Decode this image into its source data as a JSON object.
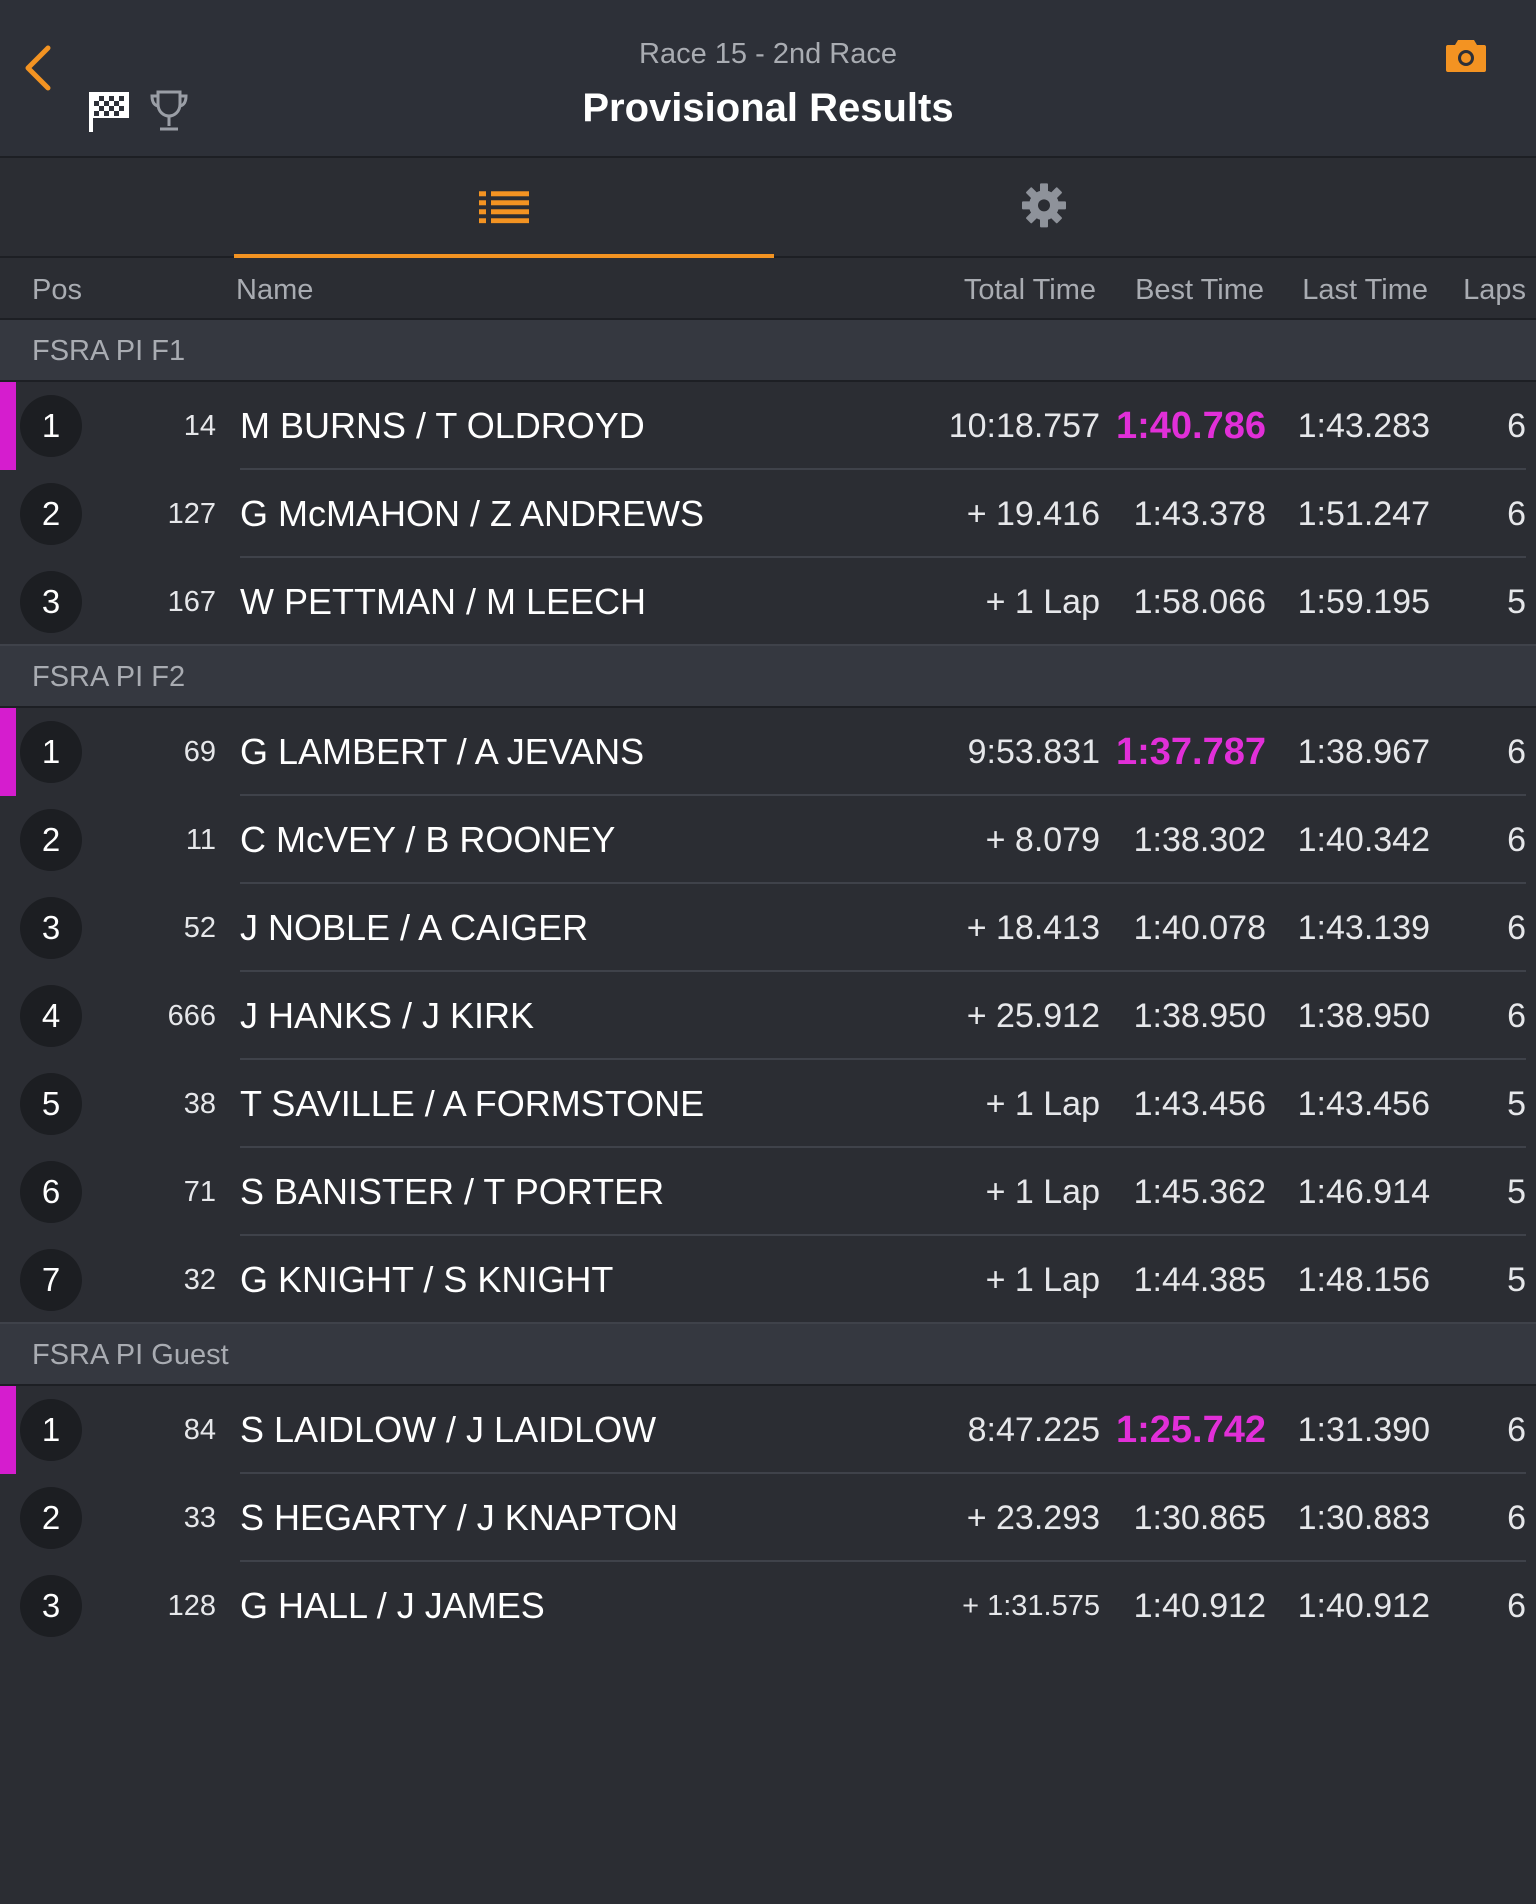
{
  "header": {
    "subtitle": "Race 15 - 2nd Race",
    "title": "Provisional Results",
    "accent_color": "#f39322",
    "icons": [
      "chevron-left-icon",
      "checkered-flag-icon",
      "trophy-icon",
      "camera-icon"
    ]
  },
  "tabs": [
    {
      "icon": "list-icon",
      "selected": true
    },
    {
      "icon": "gear-icon",
      "selected": false
    }
  ],
  "columns": {
    "pos": "Pos",
    "name": "Name",
    "total": "Total Time",
    "best": "Best Time",
    "last": "Last Time",
    "laps": "Laps"
  },
  "groups": [
    {
      "name": "FSRA PI F1",
      "rows": [
        {
          "pos": "1",
          "num": "14",
          "name": "M BURNS / T OLDROYD",
          "total": "10:18.757",
          "best": "1:40.786",
          "last": "1:43.283",
          "laps": "6",
          "fastest": true
        },
        {
          "pos": "2",
          "num": "127",
          "name": "G McMAHON / Z ANDREWS",
          "total": "+ 19.416",
          "best": "1:43.378",
          "last": "1:51.247",
          "laps": "6",
          "fastest": false
        },
        {
          "pos": "3",
          "num": "167",
          "name": "W PETTMAN / M LEECH",
          "total": "+ 1 Lap",
          "best": "1:58.066",
          "last": "1:59.195",
          "laps": "5",
          "fastest": false
        }
      ]
    },
    {
      "name": "FSRA PI F2",
      "rows": [
        {
          "pos": "1",
          "num": "69",
          "name": "G LAMBERT / A JEVANS",
          "total": "9:53.831",
          "best": "1:37.787",
          "last": "1:38.967",
          "laps": "6",
          "fastest": true
        },
        {
          "pos": "2",
          "num": "11",
          "name": "C McVEY / B ROONEY",
          "total": "+ 8.079",
          "best": "1:38.302",
          "last": "1:40.342",
          "laps": "6",
          "fastest": false
        },
        {
          "pos": "3",
          "num": "52",
          "name": "J NOBLE / A CAIGER",
          "total": "+ 18.413",
          "best": "1:40.078",
          "last": "1:43.139",
          "laps": "6",
          "fastest": false
        },
        {
          "pos": "4",
          "num": "666",
          "name": "J HANKS / J KIRK",
          "total": "+ 25.912",
          "best": "1:38.950",
          "last": "1:38.950",
          "laps": "6",
          "fastest": false
        },
        {
          "pos": "5",
          "num": "38",
          "name": "T SAVILLE / A FORMSTONE",
          "total": "+ 1 Lap",
          "best": "1:43.456",
          "last": "1:43.456",
          "laps": "5",
          "fastest": false
        },
        {
          "pos": "6",
          "num": "71",
          "name": "S BANISTER / T PORTER",
          "total": "+ 1 Lap",
          "best": "1:45.362",
          "last": "1:46.914",
          "laps": "5",
          "fastest": false
        },
        {
          "pos": "7",
          "num": "32",
          "name": "G KNIGHT / S KNIGHT",
          "total": "+ 1 Lap",
          "best": "1:44.385",
          "last": "1:48.156",
          "laps": "5",
          "fastest": false
        }
      ]
    },
    {
      "name": "FSRA PI Guest",
      "rows": [
        {
          "pos": "1",
          "num": "84",
          "name": "S LAIDLOW / J LAIDLOW",
          "total": "8:47.225",
          "best": "1:25.742",
          "last": "1:31.390",
          "laps": "6",
          "fastest": true
        },
        {
          "pos": "2",
          "num": "33",
          "name": "S HEGARTY / J KNAPTON",
          "total": "+ 23.293",
          "best": "1:30.865",
          "last": "1:30.883",
          "laps": "6",
          "fastest": false
        },
        {
          "pos": "3",
          "num": "128",
          "name": "G HALL / J JAMES",
          "total": "+ 1:31.575",
          "best": "1:40.912",
          "last": "1:40.912",
          "laps": "6",
          "fastest": false,
          "small_total": true
        }
      ]
    }
  ]
}
